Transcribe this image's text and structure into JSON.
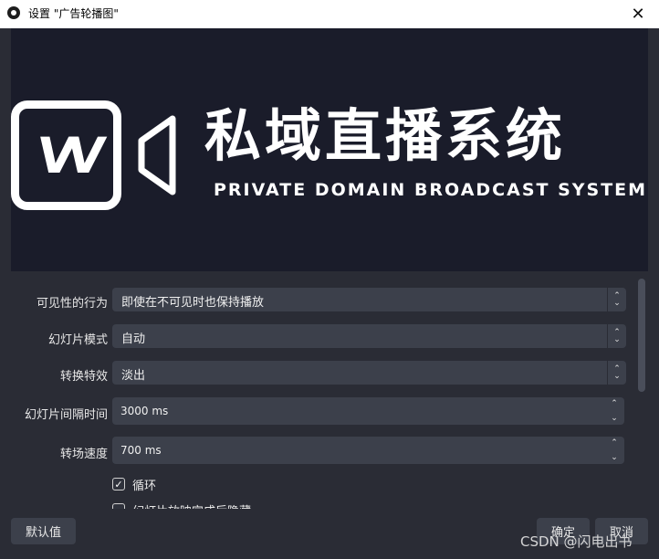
{
  "window": {
    "title": "设置 \"广告轮播图\""
  },
  "preview": {
    "brand_cn": "私域直播系统",
    "brand_en": "PRIVATE DOMAIN BROADCAST SYSTEM"
  },
  "settings": {
    "visibility_behavior": {
      "label": "可见性的行为",
      "value": "即使在不可见时也保持播放"
    },
    "slide_mode": {
      "label": "幻灯片模式",
      "value": "自动"
    },
    "transition": {
      "label": "转换特效",
      "value": "淡出"
    },
    "slide_interval": {
      "label": "幻灯片间隔时间",
      "value": "3000 ms"
    },
    "transition_speed": {
      "label": "转场速度",
      "value": "700 ms"
    },
    "loop": {
      "label": "循环",
      "checked": true
    },
    "hide_when_done": {
      "label": "幻灯片放映完成后隐藏",
      "checked": false
    }
  },
  "footer": {
    "defaults_label": "默认值",
    "ok_label": "确定",
    "cancel_label": "取消"
  },
  "watermark": "CSDN @闪电出书"
}
